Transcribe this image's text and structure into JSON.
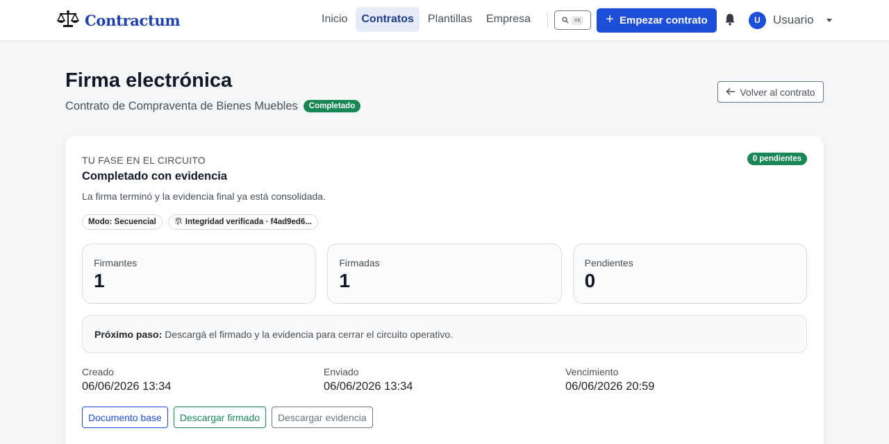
{
  "colors": {
    "accent": "#1d4ed8",
    "success": "#198754",
    "brand": "#1e40af"
  },
  "navbar": {
    "brand": "Contractum",
    "brand_icon": "scales-icon",
    "links": [
      {
        "label": "Inicio",
        "active": false
      },
      {
        "label": "Contratos",
        "active": true
      },
      {
        "label": "Plantillas",
        "active": false
      },
      {
        "label": "Empresa",
        "active": false
      }
    ],
    "search_shortcut": "⌘K",
    "cta_label": "Empezar contrato",
    "user": {
      "initial": "U",
      "name": "Usuario"
    }
  },
  "header": {
    "title": "Firma electrónica",
    "subtitle": "Contrato de Compraventa de Bienes Muebles",
    "status_badge": "Completado",
    "back_label": "Volver al contrato"
  },
  "card": {
    "phase_label": "TU FASE EN EL CIRCUITO",
    "pending_badge": "0 pendientes",
    "phase_title": "Completado con evidencia",
    "phase_desc": "La firma terminó y la evidencia final ya está consolidada.",
    "chips": {
      "mode": "Modo: Secuencial",
      "integrity": "Integridad verificada · f4ad9ed6..."
    },
    "stats": [
      {
        "label": "Firmantes",
        "value": "1"
      },
      {
        "label": "Firmadas",
        "value": "1"
      },
      {
        "label": "Pendientes",
        "value": "0"
      }
    ],
    "next_step": {
      "label": "Próximo paso:",
      "text": "Descargá el firmado y la evidencia para cerrar el circuito operativo."
    },
    "dates": [
      {
        "label": "Creado",
        "value": "06/06/2026 13:34"
      },
      {
        "label": "Enviado",
        "value": "06/06/2026 13:34"
      },
      {
        "label": "Vencimiento",
        "value": "06/06/2026 20:59"
      }
    ],
    "actions": {
      "base": "Documento base",
      "signed": "Descargar firmado",
      "evidence": "Descargar evidencia"
    }
  }
}
